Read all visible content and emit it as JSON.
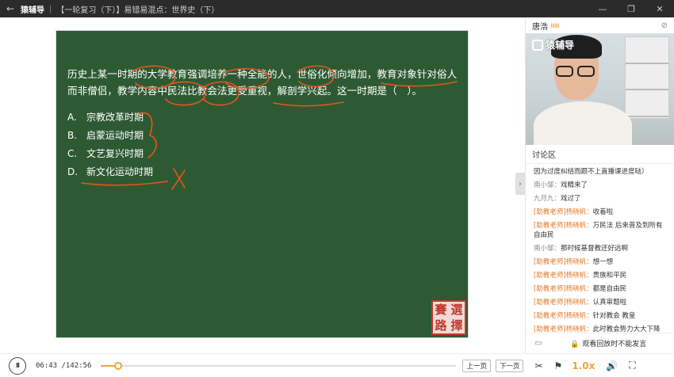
{
  "titlebar": {
    "back_icon": "←",
    "brand": "猿辅导",
    "separator": "|",
    "breadcrumb": "【一轮复习（下）】易错易混点：世界史（下）",
    "minimize_icon": "—",
    "restore_icon": "❐",
    "close_icon": "✕"
  },
  "board": {
    "question": "历史上某一时期的大学教育强调培养一种全能的人，世俗化倾向增加，教育对象针对俗人而非僧侣，教学内容中民法比教会法更受重视，解剖学兴起。这一时期是（　）。",
    "options": [
      {
        "key": "A.",
        "text": "宗教改革时期"
      },
      {
        "key": "B.",
        "text": "启蒙运动时期"
      },
      {
        "key": "C.",
        "text": "文艺复兴时期"
      },
      {
        "key": "D.",
        "text": "新文化运动时期"
      }
    ],
    "seal_chars": [
      "賽",
      "選",
      "路",
      "擇"
    ],
    "ink_color": "#e8541c"
  },
  "side_toggle": "›",
  "panel": {
    "teacher_name": "唐浩",
    "signal": "ıııııı",
    "camera_icon": "⊘",
    "video_watermark": "猿辅导",
    "discussion_title": "讨论区",
    "messages": [
      {
        "name": "",
        "text": "因为过度纠结而跟不上直播课进度哒）",
        "teacher": false
      },
      {
        "name": "南小邹：",
        "text": "戏精来了",
        "teacher": false
      },
      {
        "name": "九月九：",
        "text": "戏过了",
        "teacher": false
      },
      {
        "name": "[助教老师]杨晓帆：",
        "text": "收着啦",
        "teacher": true
      },
      {
        "name": "[助教老师]杨晓帆：",
        "text": "万民法 后来普及到所有自由民",
        "teacher": true
      },
      {
        "name": "南小邹：",
        "text": "那时候基督教还好远啊",
        "teacher": false
      },
      {
        "name": "[助教老师]杨晓帆：",
        "text": "想一想",
        "teacher": true
      },
      {
        "name": "[助教老师]杨晓帆：",
        "text": "贵族和平民",
        "teacher": true
      },
      {
        "name": "[助教老师]杨晓帆：",
        "text": "都是自由民",
        "teacher": true
      },
      {
        "name": "[助教老师]杨晓帆：",
        "text": "认真审题啦",
        "teacher": true
      },
      {
        "name": "[助教老师]杨晓帆：",
        "text": "针对教会 教皇",
        "teacher": true
      },
      {
        "name": "[助教老师]杨晓帆：",
        "text": "此时教会势力大大下降",
        "teacher": true
      }
    ],
    "footer_icon": "▭",
    "lock_icon": "🔒",
    "footer_text": "观看回放时不能发言"
  },
  "controls": {
    "play_icon": "II",
    "current_time": "06:43",
    "total_time": "/142:56",
    "progress": 0.047,
    "prev_page": "上一页",
    "next_page": "下一页",
    "scissors_icon": "✂",
    "flag_icon": "⚑",
    "speed": "1.0x",
    "volume_icon": "🔊",
    "fullscreen_icon": "⛶"
  }
}
